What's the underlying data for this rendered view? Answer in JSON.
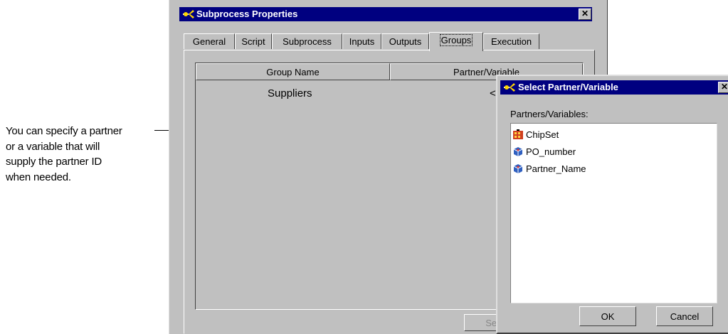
{
  "annotation": {
    "lines": [
      "You can specify a partner",
      "or a variable that will",
      "supply the partner ID",
      "when needed."
    ]
  },
  "main_window": {
    "title": "Subprocess Properties",
    "close_label": "✕",
    "tabs": [
      "General",
      "Script",
      "Subprocess",
      "Inputs",
      "Outputs",
      "Groups",
      "Execution"
    ],
    "active_tab": "Groups",
    "table": {
      "columns": [
        "Group Name",
        "Partner/Variable"
      ],
      "rows": [
        {
          "group": "Suppliers",
          "partner": "<none>"
        }
      ]
    },
    "set_button_label": "Set"
  },
  "dialog": {
    "title": "Select Partner/Variable",
    "close_label": "✕",
    "list_label": "Partners/Variables:",
    "items": [
      {
        "label": "ChipSet",
        "icon": "partner-icon"
      },
      {
        "label": "PO_number",
        "icon": "variable-icon"
      },
      {
        "label": "Partner_Name",
        "icon": "variable-icon"
      }
    ],
    "ok_label": "OK",
    "cancel_label": "Cancel"
  },
  "colors": {
    "title_bar": "#000080",
    "face": "#c0c0c0",
    "list_bg": "#ffffff"
  }
}
